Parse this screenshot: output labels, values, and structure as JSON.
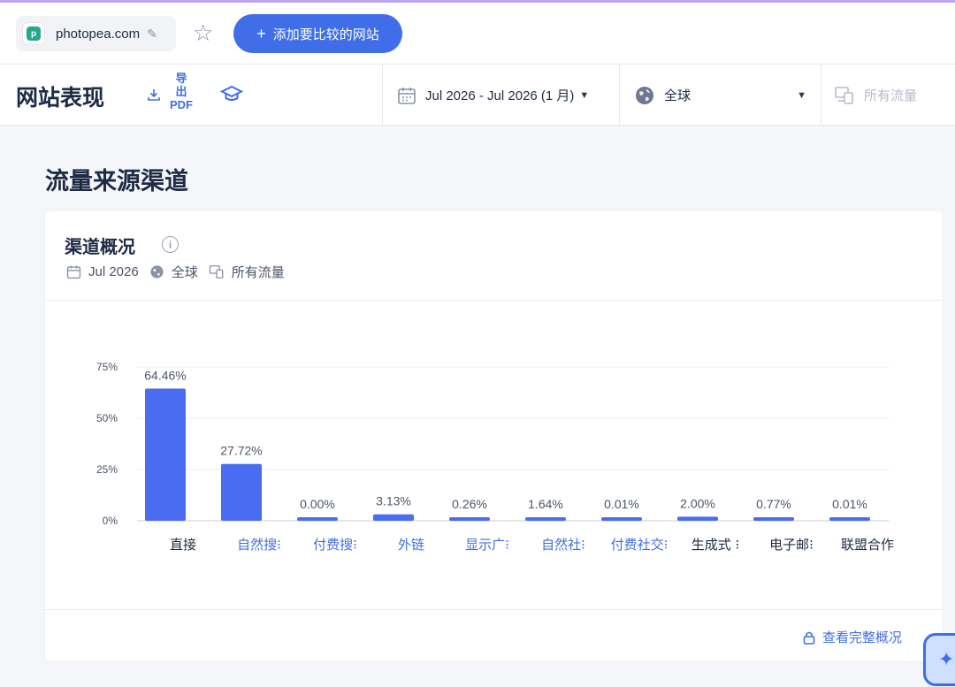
{
  "toolbar": {
    "site_name": "photopea.com",
    "add_compare_label": "添加要比较的网站"
  },
  "header": {
    "title": "网站表现",
    "export_line1": "导",
    "export_line2": "出",
    "export_line3": "PDF",
    "date_range": "Jul 2026 - Jul 2026 (1 月)",
    "geo": "全球",
    "traffic": "所有流量"
  },
  "section": {
    "title": "流量来源渠道"
  },
  "card": {
    "title": "渠道概况",
    "meta_date": "Jul 2026",
    "meta_geo": "全球",
    "meta_traffic": "所有流量",
    "full_link": "查看完整概况"
  },
  "colors": {
    "accent": "#3f6ee8",
    "bar": "#4a6cf0",
    "link_category": "#3f6ee8",
    "text": "#1f2a44"
  },
  "chart_data": {
    "type": "bar",
    "categories": [
      "直接",
      "自然搜索",
      "付费搜索",
      "外链",
      "显示广告",
      "自然社交",
      "付费社交",
      "生成式 AI",
      "电子邮件",
      "联盟合作"
    ],
    "category_display": [
      "直接",
      "自然搜⁝",
      "付费搜⁝",
      "外链",
      "显示广⁝",
      "自然社⁝",
      "付费社交⁝",
      "生成式 ⁝",
      "电子邮⁝",
      "联盟合作"
    ],
    "category_linked": [
      false,
      true,
      true,
      true,
      true,
      true,
      true,
      false,
      false,
      false
    ],
    "values": [
      64.46,
      27.72,
      0.0,
      3.13,
      0.26,
      1.64,
      0.01,
      2.0,
      0.77,
      0.01
    ],
    "data_labels": [
      "64.46%",
      "27.72%",
      "0.00%",
      "3.13%",
      "0.26%",
      "1.64%",
      "0.01%",
      "2.00%",
      "0.77%",
      "0.01%"
    ],
    "yticks": [
      "0%",
      "25%",
      "50%",
      "75%"
    ],
    "ylim": [
      0,
      75
    ],
    "grid": true
  }
}
